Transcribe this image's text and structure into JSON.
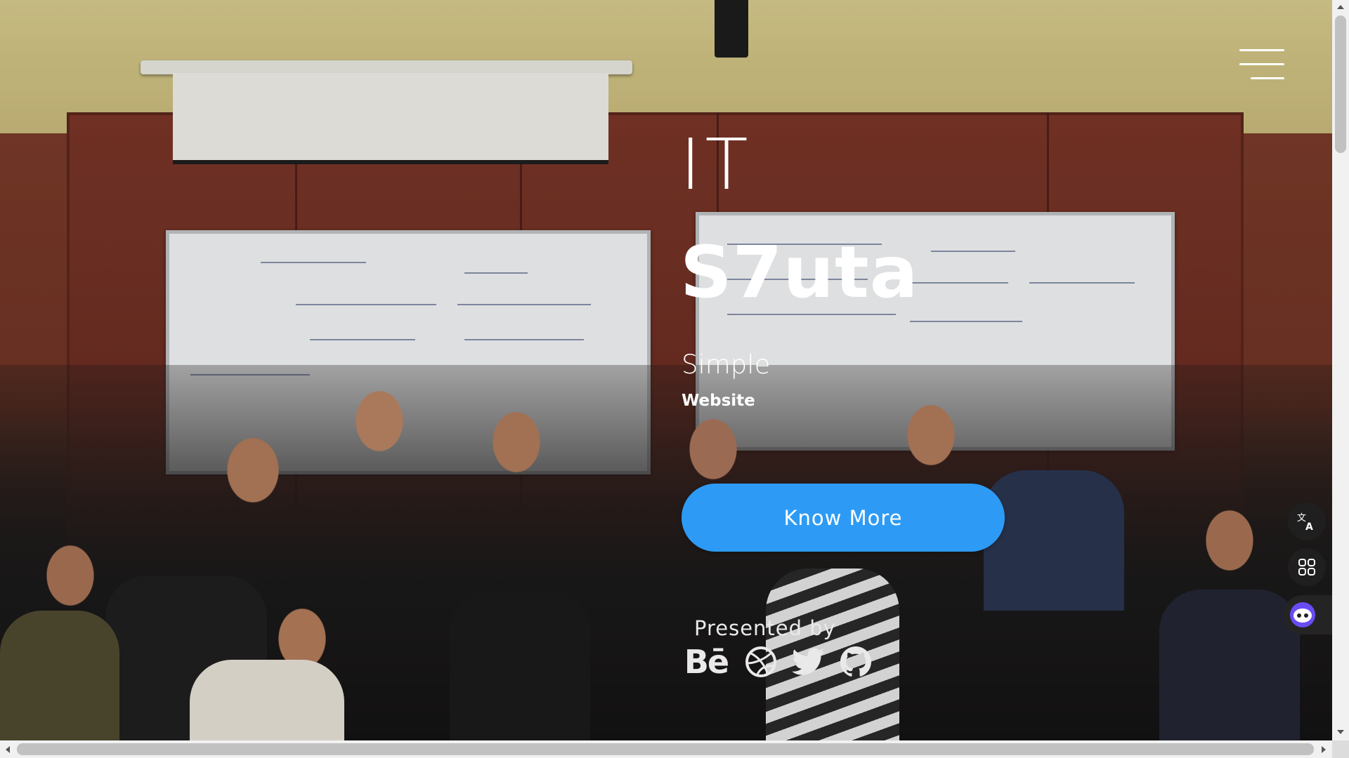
{
  "hero": {
    "title_line1": "IT",
    "title_line2": "S7uta",
    "tagline_line1": "Simple",
    "tagline_line2": "Website",
    "cta_label": "Know More"
  },
  "presented": {
    "label": "Presented by",
    "icons": [
      "behance-icon",
      "dribbble-icon",
      "twitter-icon",
      "github-icon"
    ],
    "behance_text": "Bē"
  },
  "header": {
    "menu_icon": "hamburger-menu-icon"
  },
  "widgets": {
    "translate_icon": "translate-icon",
    "apps_icon": "apps-grid-icon",
    "assistant_icon": "assistant-face-icon"
  },
  "colors": {
    "cta_background": "#2d9bf5",
    "text": "#ffffff",
    "widget_background": "#1f1f1f"
  }
}
